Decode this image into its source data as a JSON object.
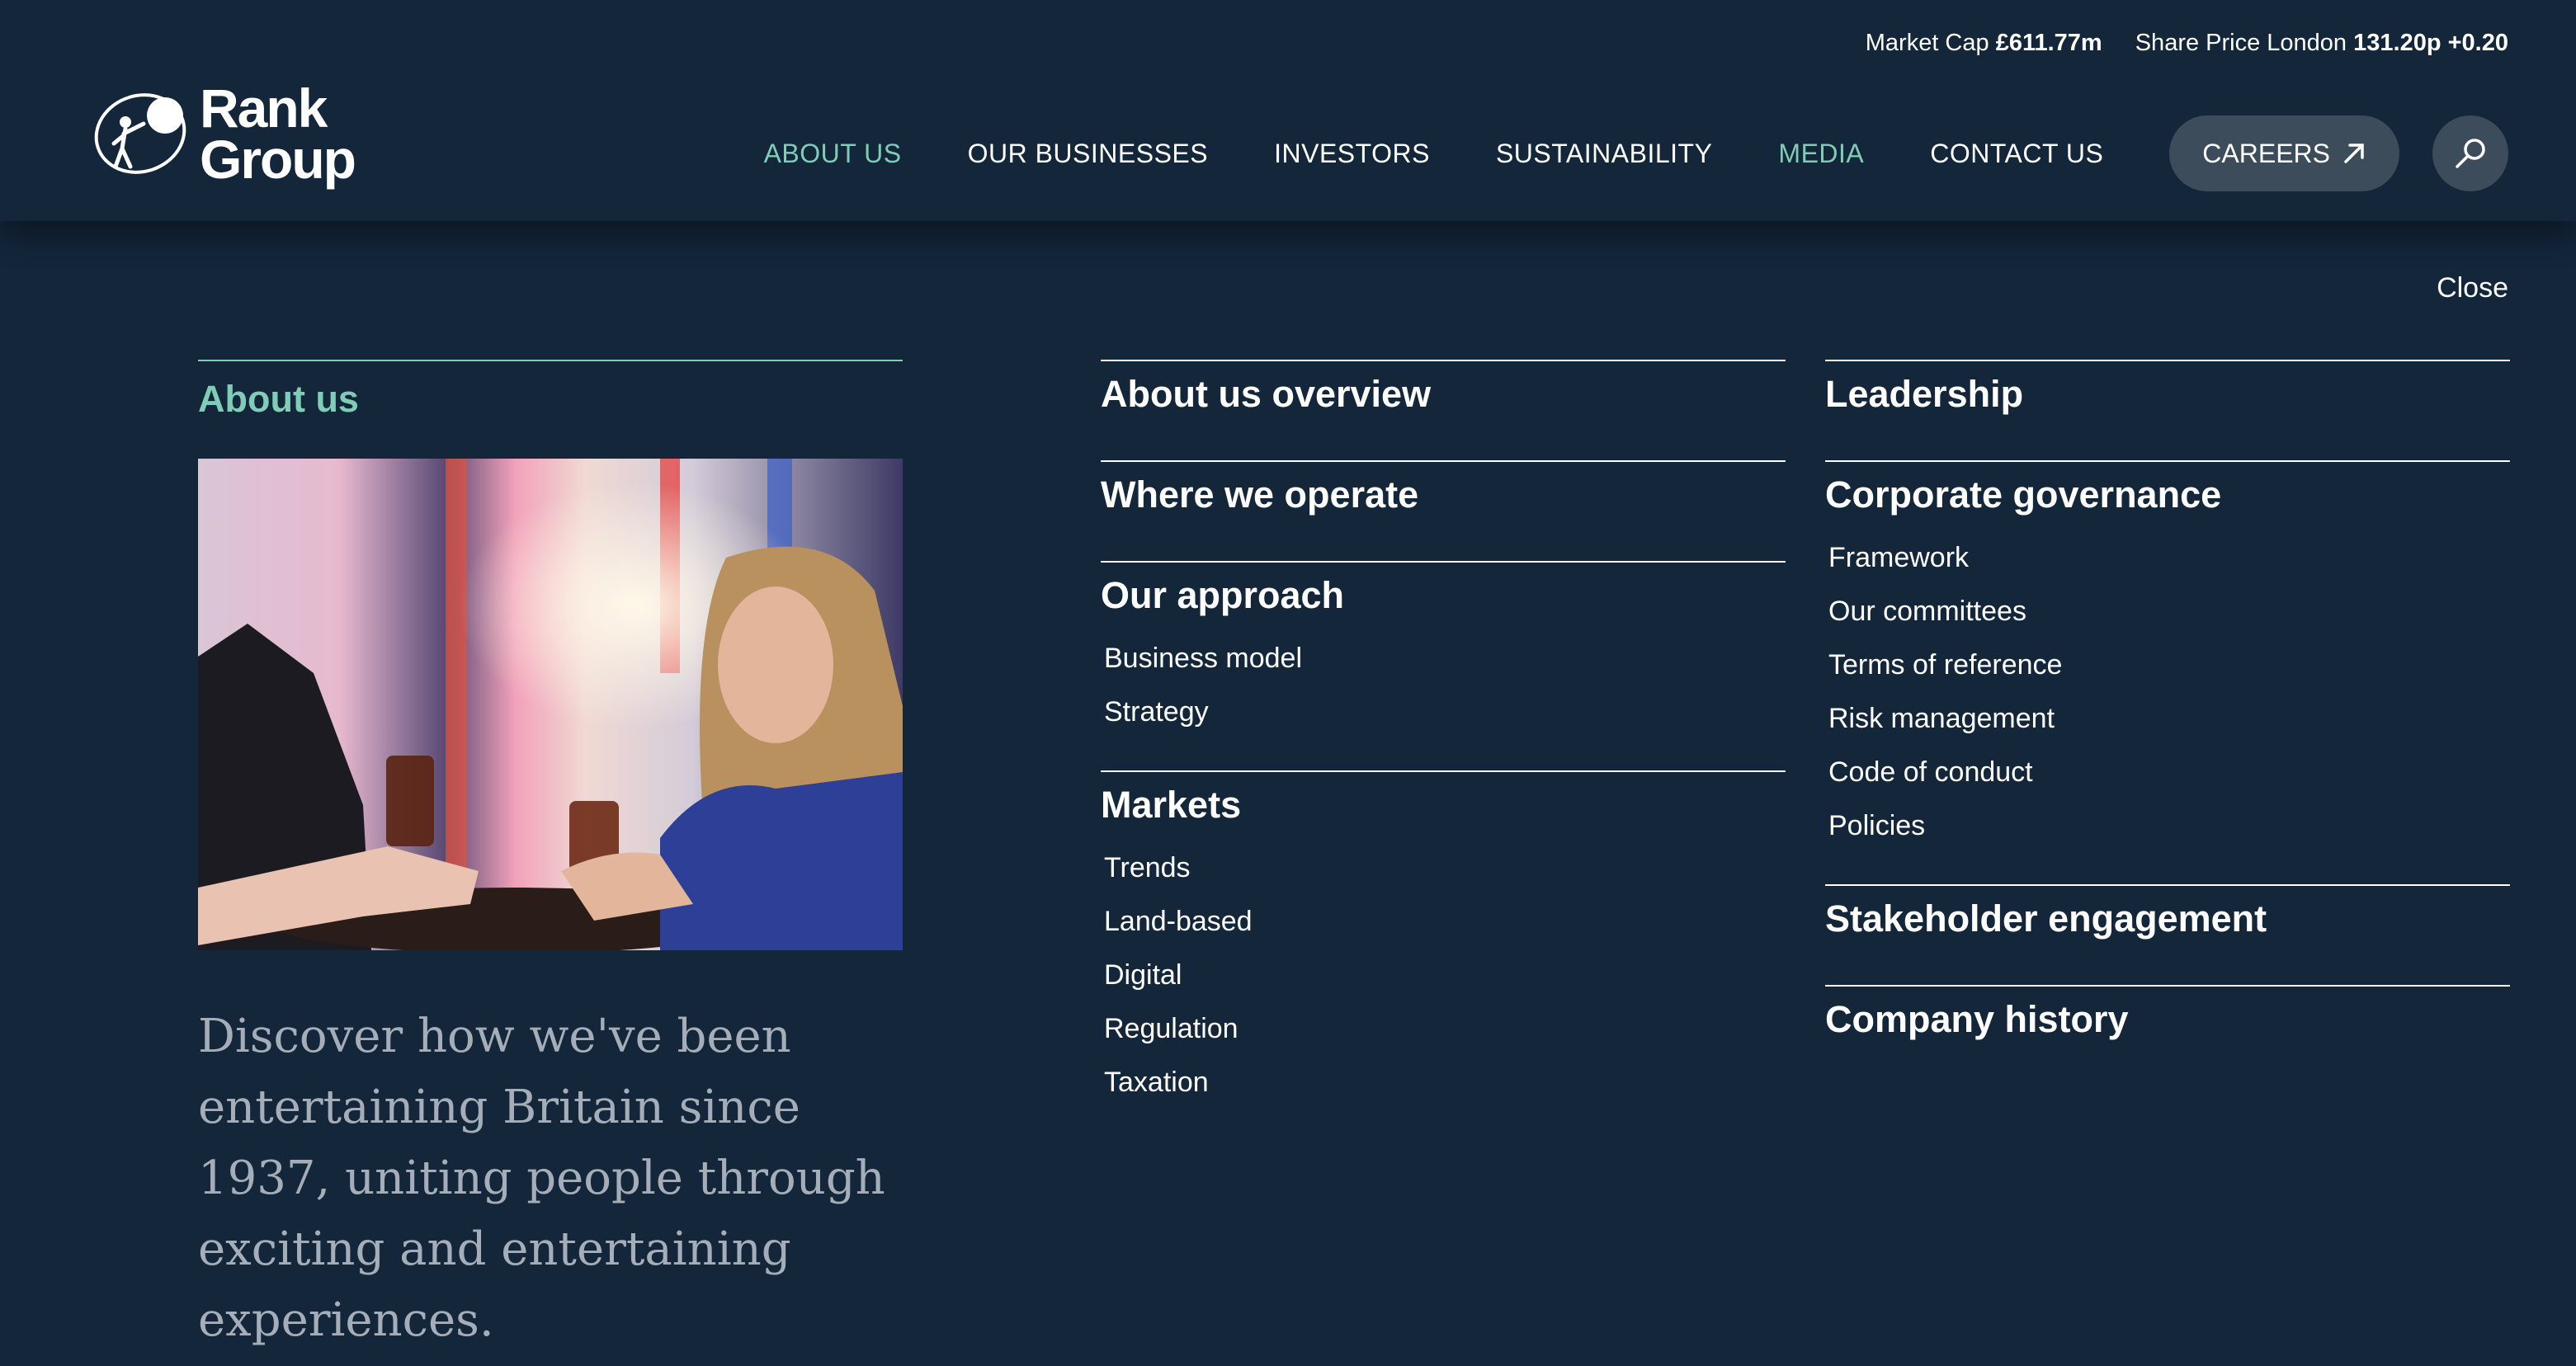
{
  "ticker": {
    "market_cap_label": "Market Cap",
    "market_cap_value": "£611.77m",
    "share_price_label": "Share Price London",
    "share_price_value": "131.20p",
    "share_price_change": "+0.20"
  },
  "logo": {
    "line1": "Rank",
    "line2": "Group"
  },
  "nav": {
    "items": [
      {
        "label": "ABOUT US",
        "active": true
      },
      {
        "label": "OUR BUSINESSES",
        "active": false
      },
      {
        "label": "INVESTORS",
        "active": false
      },
      {
        "label": "SUSTAINABILITY",
        "active": false
      },
      {
        "label": "MEDIA",
        "active": true
      },
      {
        "label": "CONTACT US",
        "active": false
      }
    ],
    "careers_label": "CAREERS"
  },
  "menu": {
    "close_label": "Close",
    "intro": {
      "title": "About us",
      "description": "Discover how we've been entertaining Britain since 1937, uniting people through exciting and entertaining experiences."
    },
    "column1": [
      {
        "title": "About us overview",
        "items": []
      },
      {
        "title": "Where we operate",
        "items": []
      },
      {
        "title": "Our approach",
        "items": [
          "Business model",
          "Strategy"
        ]
      },
      {
        "title": "Markets",
        "items": [
          "Trends",
          "Land-based",
          "Digital",
          "Regulation",
          "Taxation"
        ]
      }
    ],
    "column2": [
      {
        "title": "Leadership",
        "items": []
      },
      {
        "title": "Corporate governance",
        "items": [
          "Framework",
          "Our committees",
          "Terms of reference",
          "Risk management",
          "Code of conduct",
          "Policies"
        ]
      },
      {
        "title": "Stakeholder engagement",
        "items": []
      },
      {
        "title": "Company history",
        "items": []
      }
    ]
  },
  "colors": {
    "background": "#13263a",
    "accent": "#7fcdb6",
    "pill": "#3d4c5b"
  }
}
